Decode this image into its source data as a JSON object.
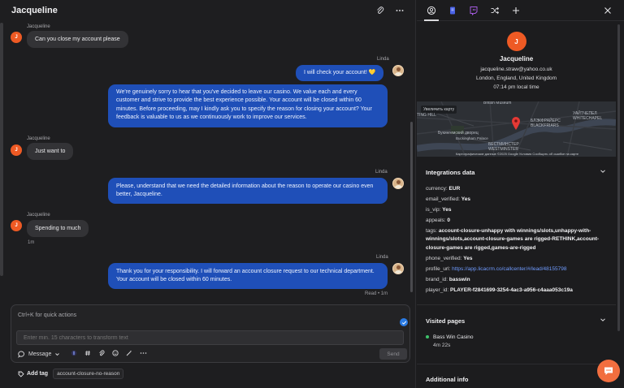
{
  "chat": {
    "title": "Jacqueline",
    "messages": [
      {
        "sender": "Jacqueline",
        "text": "Can you close my account please",
        "avatar": "J"
      },
      {
        "sender": "Linda",
        "text": "I will check your account! 💛"
      },
      {
        "text": "We're genuinely sorry to hear that you've decided to leave our casino. We value each and every customer and strive to provide the best experience possible. Your account will be closed within 60 minutes. Before proceeding, may I kindly ask you to specify the reason for closing your account? Your feedback is valuable to us as we continuously work to improve our services."
      },
      {
        "sender": "Jacqueline",
        "text": "Just want to",
        "avatar": "J"
      },
      {
        "sender": "Linda",
        "text": "Please, understand that we need the detailed information about the reason to operate our casino even better, Jacqueline."
      },
      {
        "sender": "Jacqueline",
        "text": "Spending to much",
        "avatar": "J",
        "time": "1m"
      },
      {
        "sender": "Linda",
        "text": "Thank you for your responsibility. I will forward an account closure request to our technical department. Your account will be closed within 60 minutes.",
        "status": "Read • 1m"
      }
    ]
  },
  "composer": {
    "hint": "Ctrl+K for quick actions",
    "transform_placeholder": "Enter min. 15 characters to transform text",
    "mode_label": "Message",
    "send_label": "Send"
  },
  "tags": {
    "add_label": "Add tag",
    "items": [
      "account-closure-no-reason"
    ]
  },
  "profile": {
    "avatar": "J",
    "name": "Jacqueline",
    "email": "jacqueline.straw@yahoo.co.uk",
    "location": "London, England, United Kingdom",
    "local_time": "07:14 pm local time"
  },
  "map": {
    "enlarge_label": "Увеличить карту",
    "labels": [
      "British Museum",
      "TING HILL",
      "Букингемский дворец",
      "Buckingham Palace",
      "БЛЭКФРАЙЕРС",
      "BLACKFRIARS",
      "УАЙТЧЕПЕЛ",
      "WHITECHAPEL",
      "БЕСТМИНСТЕР",
      "WESTMINSTER"
    ],
    "footer": "Картографические данные ©2025 Google   Условия   Сообщить об ошибке на карте"
  },
  "integrations": {
    "title": "Integrations data",
    "fields": [
      {
        "key": "currency:",
        "value": "EUR"
      },
      {
        "key": "email_verified:",
        "value": "Yes"
      },
      {
        "key": "is_vip:",
        "value": "Yes"
      },
      {
        "key": "appeals:",
        "value": "0"
      },
      {
        "key": "tags:",
        "value": "account-closure-unhappy with winnings/slots,unhappy-with-winnings/slots,account-closure-games are rigged-RETHINK,account-closure-games are rigged,games-are-rigged"
      },
      {
        "key": "phone_verified:",
        "value": "Yes"
      },
      {
        "key": "profile_url:",
        "value": "https://app.licacrm.co/callcenter/#/lead/48155798"
      },
      {
        "key": "brand_id:",
        "value": "basswin"
      },
      {
        "key": "player_id:",
        "value": "PLAYER-f2841699-3254-4ac3-a956-c4aaa053c19a"
      }
    ]
  },
  "visited": {
    "title": "Visited pages",
    "items": [
      {
        "name": "Bass Win Casino",
        "duration": "4m 22s"
      }
    ]
  },
  "additional": {
    "title": "Additional info"
  },
  "colors": {
    "accent": "#1f4fb8",
    "avatar": "#ee5a24",
    "fab": "#f26e3f"
  }
}
